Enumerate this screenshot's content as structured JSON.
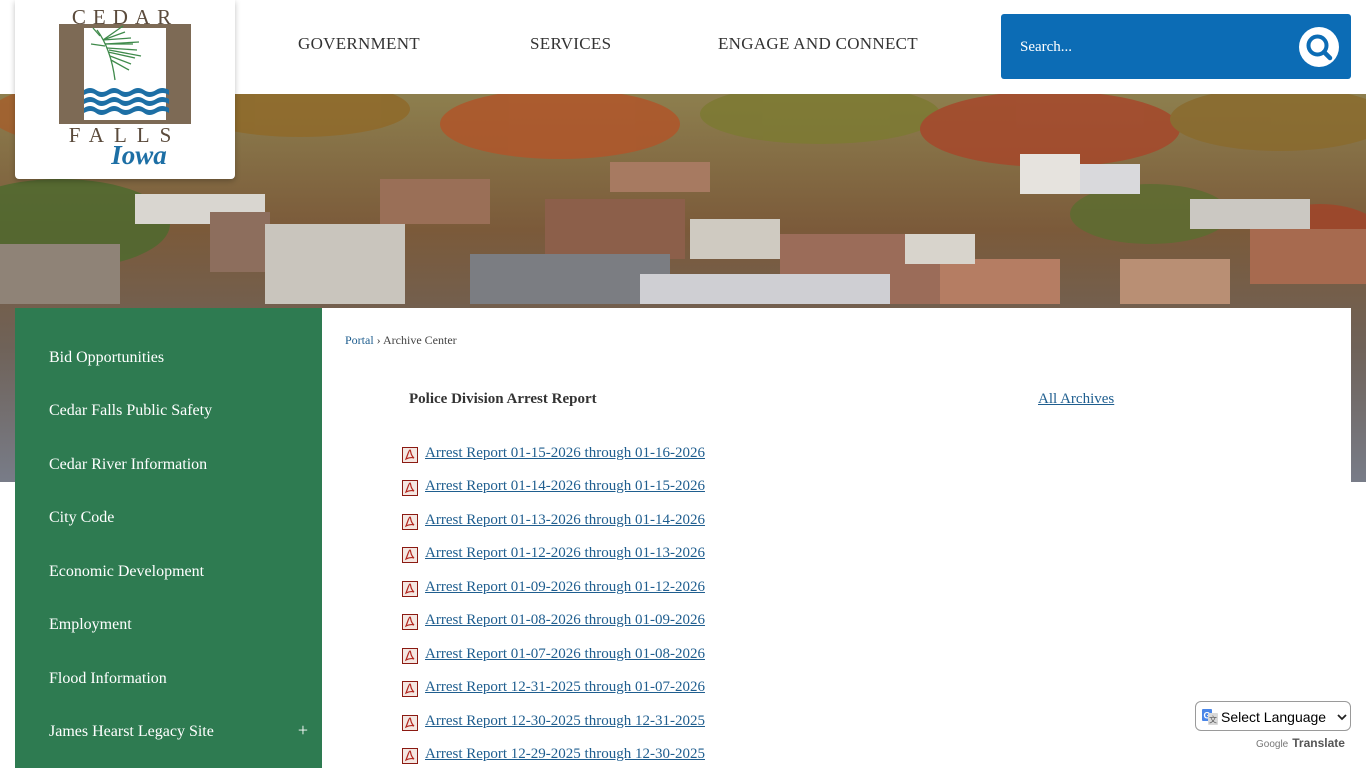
{
  "logo": {
    "line1": "CEDAR",
    "line2": "FALLS",
    "script": "Iowa"
  },
  "nav": {
    "items": [
      "GOVERNMENT",
      "SERVICES",
      "ENGAGE AND CONNECT"
    ]
  },
  "search": {
    "placeholder": "Search..."
  },
  "sidebar": {
    "items": [
      {
        "label": "Bid Opportunities"
      },
      {
        "label": "Cedar Falls Public Safety"
      },
      {
        "label": "Cedar River Information"
      },
      {
        "label": "City Code"
      },
      {
        "label": "Economic Development"
      },
      {
        "label": "Employment"
      },
      {
        "label": "Flood Information"
      },
      {
        "label": "James Hearst Legacy Site",
        "expand": "+"
      }
    ]
  },
  "breadcrumb": {
    "portal": "Portal",
    "separator": " › ",
    "current": "Archive Center"
  },
  "archive": {
    "title": "Police Division Arrest Report",
    "all_link": "All Archives",
    "reports": [
      "Arrest Report 01-15-2026 through 01-16-2026",
      "Arrest Report 01-14-2026 through 01-15-2026",
      "Arrest Report 01-13-2026 through 01-14-2026",
      "Arrest Report 01-12-2026 through 01-13-2026",
      "Arrest Report 01-09-2026 through 01-12-2026",
      "Arrest Report 01-08-2026 through 01-09-2026",
      "Arrest Report 01-07-2026 through 01-08-2026",
      "Arrest Report 12-31-2025 through 01-07-2026",
      "Arrest Report 12-30-2025 through 12-31-2025",
      "Arrest Report 12-29-2025 through 12-30-2025"
    ]
  },
  "translate": {
    "select_label": "Select Language",
    "powered_by": "Google",
    "translate_label": "Translate"
  },
  "colors": {
    "search_blue": "#0c6cb5",
    "sidebar_green": "#2e7b51",
    "link_blue": "#1f5e8f",
    "logo_brown": "#7d6a55",
    "logo_teal": "#1d6fa5"
  },
  "icons": [
    "search-icon",
    "pdf-icon",
    "google-translate-icon",
    "chevron-down-icon",
    "plus-icon"
  ]
}
